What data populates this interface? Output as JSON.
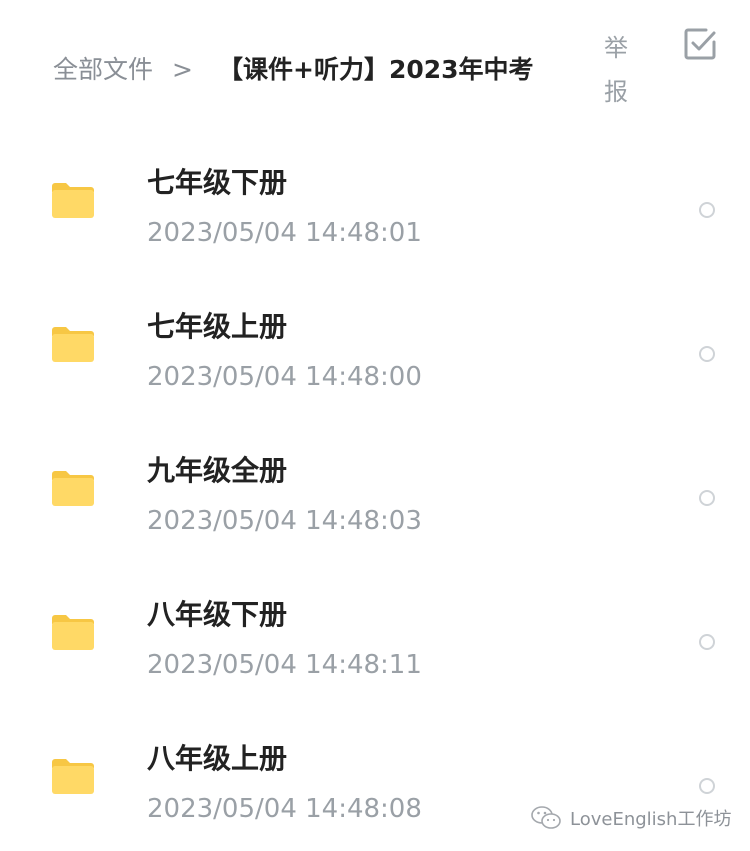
{
  "header": {
    "breadcrumb_root": "全部文件",
    "breadcrumb_separator": ">",
    "breadcrumb_current": "【课件+听力】2023年中考",
    "report_label_line1": "举",
    "report_label_line2": "报"
  },
  "icons": {
    "folder": "folder-icon",
    "select_all": "checkbox-icon",
    "row_select": "radio-circle-icon",
    "watermark": "wechat-icon"
  },
  "colors": {
    "folder_body": "#FFD966",
    "folder_tab": "#F7C744",
    "text_primary": "#222222",
    "text_secondary": "#9AA0A6"
  },
  "files": [
    {
      "name": "七年级下册",
      "modified": "2023/05/04 14:48:01"
    },
    {
      "name": "七年级上册",
      "modified": "2023/05/04 14:48:00"
    },
    {
      "name": "九年级全册",
      "modified": "2023/05/04 14:48:03"
    },
    {
      "name": "八年级下册",
      "modified": "2023/05/04 14:48:11"
    },
    {
      "name": "八年级上册",
      "modified": "2023/05/04 14:48:08"
    }
  ],
  "watermark": {
    "text": "LoveEnglish工作坊"
  }
}
